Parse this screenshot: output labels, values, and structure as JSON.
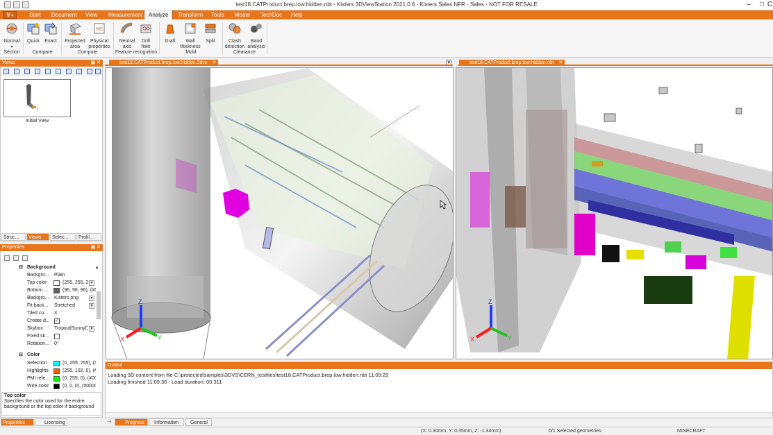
{
  "window": {
    "title": "test18.CATProduct.brep.low.hidden.nbt - Kisters 3DViewStation 2021.0.6 - Kisters Sales NFR - Sales - NOT FOR RESALE",
    "partial_right_glyph": "C",
    "minimize": "–",
    "maximize": "□"
  },
  "menu": {
    "logo": "V",
    "items": [
      "Start",
      "Document",
      "View",
      "Measurement",
      "Analyze",
      "Transform",
      "Tools",
      "Model",
      "TechDoc",
      "Help"
    ],
    "active": "Analyze"
  },
  "ribbon": {
    "buttons": {
      "normal": "Normal",
      "quick": "Quick",
      "exact": "Exact",
      "projected_area": [
        "Projected",
        "area"
      ],
      "physical_properties": [
        "Physical",
        "properties"
      ],
      "neutral_axis": [
        "Neutral",
        "axis"
      ],
      "drill_hole": [
        "Drill",
        "hole"
      ],
      "draft": "Draft",
      "wall_thickness": [
        "Wall",
        "thickness"
      ],
      "split": "Split",
      "clash_detection": [
        "Clash",
        "detection"
      ],
      "band_analysis": [
        "Band",
        "analysis"
      ]
    },
    "groups": {
      "section": "Section",
      "compare": "Compare",
      "compute": "Compute",
      "feature_recognition": "Feature recognition",
      "mold": "Mold",
      "clearance": "Clearance"
    }
  },
  "views_panel": {
    "title": "Views",
    "thumbnail_label": "Initial View",
    "tabs": [
      "Struc...",
      "Views",
      "Selec...",
      "Profil..."
    ],
    "active_tab": "Views"
  },
  "properties_panel": {
    "title": "Properties",
    "categories": {
      "background": "Background",
      "color": "Color"
    },
    "rows": {
      "background_type": {
        "key": "Backgro...",
        "value": "Plain"
      },
      "top_color": {
        "key": "Top color",
        "value": "(255, 255, 25",
        "swatch": "#ffffff"
      },
      "bottom_color": {
        "key": "Bottom ...",
        "value": "(96, 96, 96), (#6",
        "swatch": "#606060"
      },
      "background_image": {
        "key": "Backgro...",
        "value": "Kisters.png"
      },
      "fit_background": {
        "key": "Fit back...",
        "value": "Stretched"
      },
      "tiled_count": {
        "key": "Tiled co...",
        "value": "3"
      },
      "create_d": {
        "key": "Create d...",
        "checked": true
      },
      "skybox": {
        "key": "Skybox",
        "value": "TropicalSunnyD"
      },
      "fixed_skybox": {
        "key": "Fixed sk...",
        "checked": false
      },
      "rotation": {
        "key": "Rotation...",
        "value": "0°"
      },
      "selection": {
        "key": "Selection",
        "value": "(0, 255, 255), (#",
        "swatch": "#00ffff"
      },
      "highlights": {
        "key": "Highlights",
        "value": "(255, 102, 0), (#",
        "swatch": "#ff6600"
      },
      "pmi_reference": {
        "key": "PMI refe...",
        "value": "(0, 255, 0), (#00",
        "swatch": "#00ff00"
      },
      "wire_color": {
        "key": "Wire color",
        "value": "(0, 0, 0), (#0000",
        "swatch": "#000000"
      }
    },
    "help_title": "Top color",
    "help_text": "Specifies the color used for the entire background or the top color if background",
    "tabs": [
      "Properties",
      "Licensing"
    ],
    "active_tab": "Properties"
  },
  "viewports": {
    "left_tab": "test18.CATProduct.brep.low.hidden.3dvs",
    "right_tab": "test18.CATProduct.brep.low.hidden.nbt",
    "axes": {
      "x": "X",
      "y": "Y",
      "z": "Z"
    }
  },
  "output": {
    "title": "Output",
    "lines": [
      "Loading 3D content from file C:\\protected\\samples\\3DVS\\CERN_testfiles\\test18.CATProduct.brep.low.hidden.nbt 11:09:29",
      "Loading finished 11:09:30 - Load duration: 00.311"
    ],
    "tabs": [
      "Progress",
      "Information",
      "General"
    ],
    "active_tab": "Progress"
  },
  "status": {
    "coordinates": "(X: 0.34mm, Y: 0.35mm, Z: -1.34mm)",
    "selection": "0/1 Selected geometries",
    "user": "MINECRAFT"
  },
  "colors": {
    "accent": "#e8751a",
    "selection": "#00ffff",
    "highlight": "#ff6600"
  }
}
